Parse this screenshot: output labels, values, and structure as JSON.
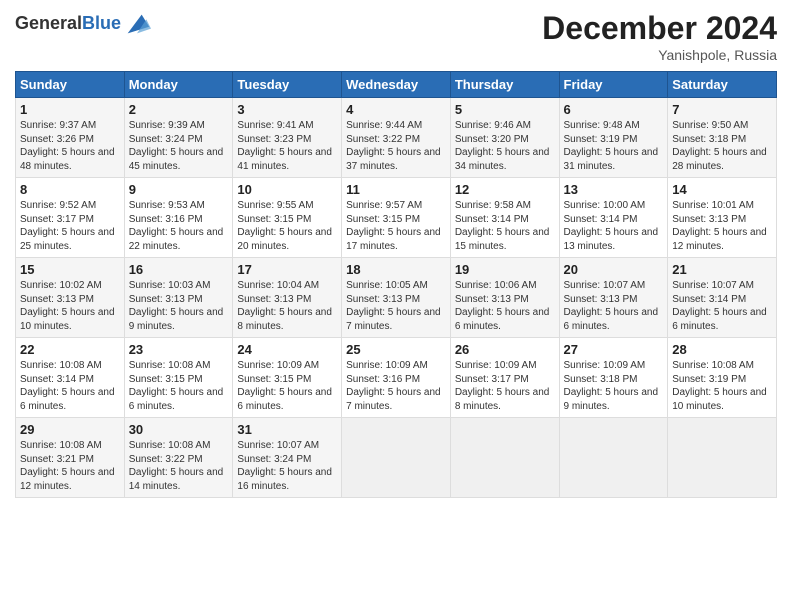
{
  "header": {
    "logo_line1": "General",
    "logo_line2": "Blue",
    "month": "December 2024",
    "location": "Yanishpole, Russia"
  },
  "weekdays": [
    "Sunday",
    "Monday",
    "Tuesday",
    "Wednesday",
    "Thursday",
    "Friday",
    "Saturday"
  ],
  "weeks": [
    [
      {
        "day": "1",
        "sunrise": "9:37 AM",
        "sunset": "3:26 PM",
        "daylight": "5 hours and 48 minutes."
      },
      {
        "day": "2",
        "sunrise": "9:39 AM",
        "sunset": "3:24 PM",
        "daylight": "5 hours and 45 minutes."
      },
      {
        "day": "3",
        "sunrise": "9:41 AM",
        "sunset": "3:23 PM",
        "daylight": "5 hours and 41 minutes."
      },
      {
        "day": "4",
        "sunrise": "9:44 AM",
        "sunset": "3:22 PM",
        "daylight": "5 hours and 37 minutes."
      },
      {
        "day": "5",
        "sunrise": "9:46 AM",
        "sunset": "3:20 PM",
        "daylight": "5 hours and 34 minutes."
      },
      {
        "day": "6",
        "sunrise": "9:48 AM",
        "sunset": "3:19 PM",
        "daylight": "5 hours and 31 minutes."
      },
      {
        "day": "7",
        "sunrise": "9:50 AM",
        "sunset": "3:18 PM",
        "daylight": "5 hours and 28 minutes."
      }
    ],
    [
      {
        "day": "8",
        "sunrise": "9:52 AM",
        "sunset": "3:17 PM",
        "daylight": "5 hours and 25 minutes."
      },
      {
        "day": "9",
        "sunrise": "9:53 AM",
        "sunset": "3:16 PM",
        "daylight": "5 hours and 22 minutes."
      },
      {
        "day": "10",
        "sunrise": "9:55 AM",
        "sunset": "3:15 PM",
        "daylight": "5 hours and 20 minutes."
      },
      {
        "day": "11",
        "sunrise": "9:57 AM",
        "sunset": "3:15 PM",
        "daylight": "5 hours and 17 minutes."
      },
      {
        "day": "12",
        "sunrise": "9:58 AM",
        "sunset": "3:14 PM",
        "daylight": "5 hours and 15 minutes."
      },
      {
        "day": "13",
        "sunrise": "10:00 AM",
        "sunset": "3:14 PM",
        "daylight": "5 hours and 13 minutes."
      },
      {
        "day": "14",
        "sunrise": "10:01 AM",
        "sunset": "3:13 PM",
        "daylight": "5 hours and 12 minutes."
      }
    ],
    [
      {
        "day": "15",
        "sunrise": "10:02 AM",
        "sunset": "3:13 PM",
        "daylight": "5 hours and 10 minutes."
      },
      {
        "day": "16",
        "sunrise": "10:03 AM",
        "sunset": "3:13 PM",
        "daylight": "5 hours and 9 minutes."
      },
      {
        "day": "17",
        "sunrise": "10:04 AM",
        "sunset": "3:13 PM",
        "daylight": "5 hours and 8 minutes."
      },
      {
        "day": "18",
        "sunrise": "10:05 AM",
        "sunset": "3:13 PM",
        "daylight": "5 hours and 7 minutes."
      },
      {
        "day": "19",
        "sunrise": "10:06 AM",
        "sunset": "3:13 PM",
        "daylight": "5 hours and 6 minutes."
      },
      {
        "day": "20",
        "sunrise": "10:07 AM",
        "sunset": "3:13 PM",
        "daylight": "5 hours and 6 minutes."
      },
      {
        "day": "21",
        "sunrise": "10:07 AM",
        "sunset": "3:14 PM",
        "daylight": "5 hours and 6 minutes."
      }
    ],
    [
      {
        "day": "22",
        "sunrise": "10:08 AM",
        "sunset": "3:14 PM",
        "daylight": "5 hours and 6 minutes."
      },
      {
        "day": "23",
        "sunrise": "10:08 AM",
        "sunset": "3:15 PM",
        "daylight": "5 hours and 6 minutes."
      },
      {
        "day": "24",
        "sunrise": "10:09 AM",
        "sunset": "3:15 PM",
        "daylight": "5 hours and 6 minutes."
      },
      {
        "day": "25",
        "sunrise": "10:09 AM",
        "sunset": "3:16 PM",
        "daylight": "5 hours and 7 minutes."
      },
      {
        "day": "26",
        "sunrise": "10:09 AM",
        "sunset": "3:17 PM",
        "daylight": "5 hours and 8 minutes."
      },
      {
        "day": "27",
        "sunrise": "10:09 AM",
        "sunset": "3:18 PM",
        "daylight": "5 hours and 9 minutes."
      },
      {
        "day": "28",
        "sunrise": "10:08 AM",
        "sunset": "3:19 PM",
        "daylight": "5 hours and 10 minutes."
      }
    ],
    [
      {
        "day": "29",
        "sunrise": "10:08 AM",
        "sunset": "3:21 PM",
        "daylight": "5 hours and 12 minutes."
      },
      {
        "day": "30",
        "sunrise": "10:08 AM",
        "sunset": "3:22 PM",
        "daylight": "5 hours and 14 minutes."
      },
      {
        "day": "31",
        "sunrise": "10:07 AM",
        "sunset": "3:24 PM",
        "daylight": "5 hours and 16 minutes."
      },
      null,
      null,
      null,
      null
    ]
  ]
}
